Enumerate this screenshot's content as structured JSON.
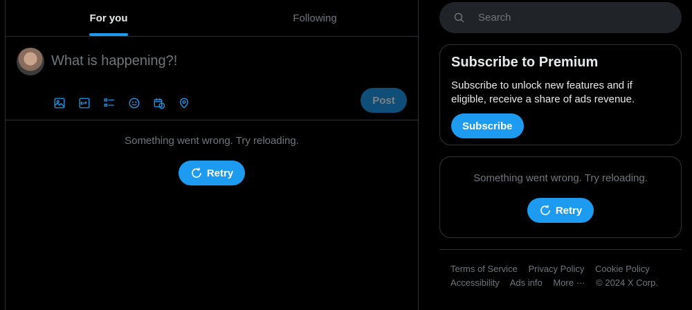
{
  "tabs": [
    {
      "label": "For you",
      "active": true
    },
    {
      "label": "Following",
      "active": false
    }
  ],
  "composer": {
    "placeholder": "What is happening?!",
    "post_label": "Post",
    "tools": [
      "image-icon",
      "gif-icon",
      "poll-icon",
      "emoji-icon",
      "schedule-icon",
      "location-icon"
    ]
  },
  "feed_error": {
    "message": "Something went wrong. Try reloading.",
    "retry_label": "Retry"
  },
  "search": {
    "placeholder": "Search"
  },
  "premium": {
    "title": "Subscribe to Premium",
    "description": "Subscribe to unlock new features and if eligible, receive a share of ads revenue.",
    "button_label": "Subscribe"
  },
  "side_error": {
    "message": "Something went wrong. Try reloading.",
    "retry_label": "Retry"
  },
  "footer": {
    "links": [
      "Terms of Service",
      "Privacy Policy",
      "Cookie Policy",
      "Accessibility",
      "Ads info",
      "More ···"
    ],
    "copyright": "© 2024 X Corp."
  },
  "colors": {
    "accent": "#1d9bf0",
    "background": "#000000",
    "border": "#2f3336",
    "muted": "#71767b"
  }
}
